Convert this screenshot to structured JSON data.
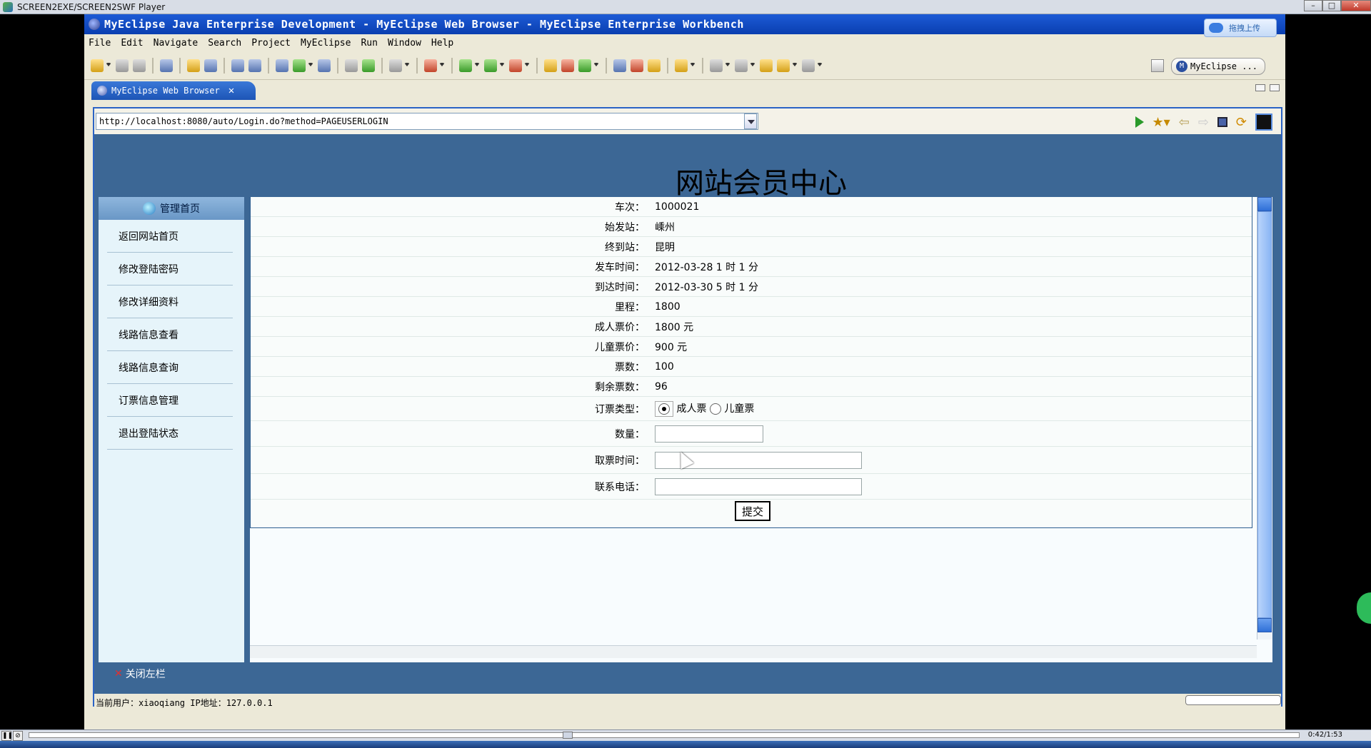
{
  "player": {
    "title": "SCREEN2EXE/SCREEN2SWF Player",
    "time": "0:42/1:53"
  },
  "eclipse": {
    "title": "MyEclipse Java Enterprise Development - MyEclipse Web Browser - MyEclipse Enterprise Workbench",
    "upload_button": "拖拽上传",
    "menu": [
      "File",
      "Edit",
      "Navigate",
      "Search",
      "Project",
      "MyEclipse",
      "Run",
      "Window",
      "Help"
    ],
    "perspective": "MyEclipse ...",
    "tab_title": "MyEclipse Web Browser"
  },
  "browser": {
    "url": "http://localhost:8080/auto/Login.do?method=PAGEUSERLOGIN"
  },
  "site": {
    "title": "网站会员中心",
    "sidebar_head": "管理首页",
    "sidebar_items": [
      "返回网站首页",
      "修改登陆密码",
      "修改详细资料",
      "线路信息查看",
      "线路信息查询",
      "订票信息管理",
      "退出登陆状态"
    ],
    "close_left": "关闭左栏",
    "footer": "当前用户：xiaoqiang  IP地址：127.0.0.1"
  },
  "form": {
    "rows": [
      {
        "label": "车次：",
        "value": "1000021"
      },
      {
        "label": "始发站：",
        "value": "嵊州"
      },
      {
        "label": "终到站：",
        "value": "昆明"
      },
      {
        "label": "发车时间：",
        "value": "2012-03-28 1 时 1 分"
      },
      {
        "label": "到达时间：",
        "value": "2012-03-30 5 时 1 分"
      },
      {
        "label": "里程：",
        "value": "1800"
      },
      {
        "label": "成人票价：",
        "value": "1800 元"
      },
      {
        "label": "儿童票价：",
        "value": "900 元"
      },
      {
        "label": "票数：",
        "value": "100"
      },
      {
        "label": "剩余票数：",
        "value": "96"
      }
    ],
    "ticket_type_label": "订票类型：",
    "ticket_type_adult": "成人票",
    "ticket_type_child": "儿童票",
    "quantity_label": "数量：",
    "quantity_value": "",
    "pickup_time_label": "取票时间：",
    "pickup_time_value": "",
    "phone_label": "联系电话：",
    "phone_value": "",
    "submit_label": "提交"
  }
}
